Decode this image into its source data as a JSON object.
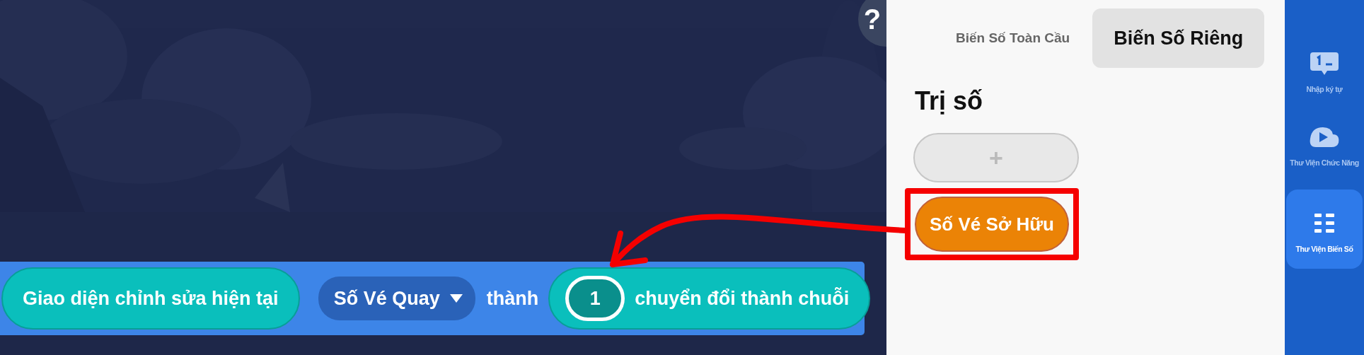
{
  "help_button": {
    "label": "?"
  },
  "block": {
    "parts": [
      {
        "kind": "reporter",
        "text": "Giao diện chỉnh sửa hiện tại"
      },
      {
        "kind": "dropdown",
        "text": "Số Vé Quay"
      },
      {
        "kind": "label",
        "text": "thành"
      },
      {
        "kind": "reporter_input",
        "value": "1",
        "text": "chuyển đổi thành chuỗi"
      }
    ]
  },
  "panel": {
    "tabs": [
      {
        "label": "Biến Số Toàn Cầu",
        "selected": false
      },
      {
        "label": "Biến Số Riêng",
        "selected": true
      }
    ],
    "section_title": "Trị số",
    "add_button": {
      "label": "+"
    },
    "variables": [
      {
        "label": "Số Vé Sở Hữu",
        "highlighted": true
      }
    ]
  },
  "sidebar": {
    "items": [
      {
        "kind": "input",
        "label": "Nhập ký tự",
        "selected": false
      },
      {
        "kind": "functions",
        "label": "Thư Viện Chức Năng",
        "selected": false
      },
      {
        "kind": "variables",
        "label": "Thư Viện Biến Số",
        "selected": true
      }
    ]
  }
}
